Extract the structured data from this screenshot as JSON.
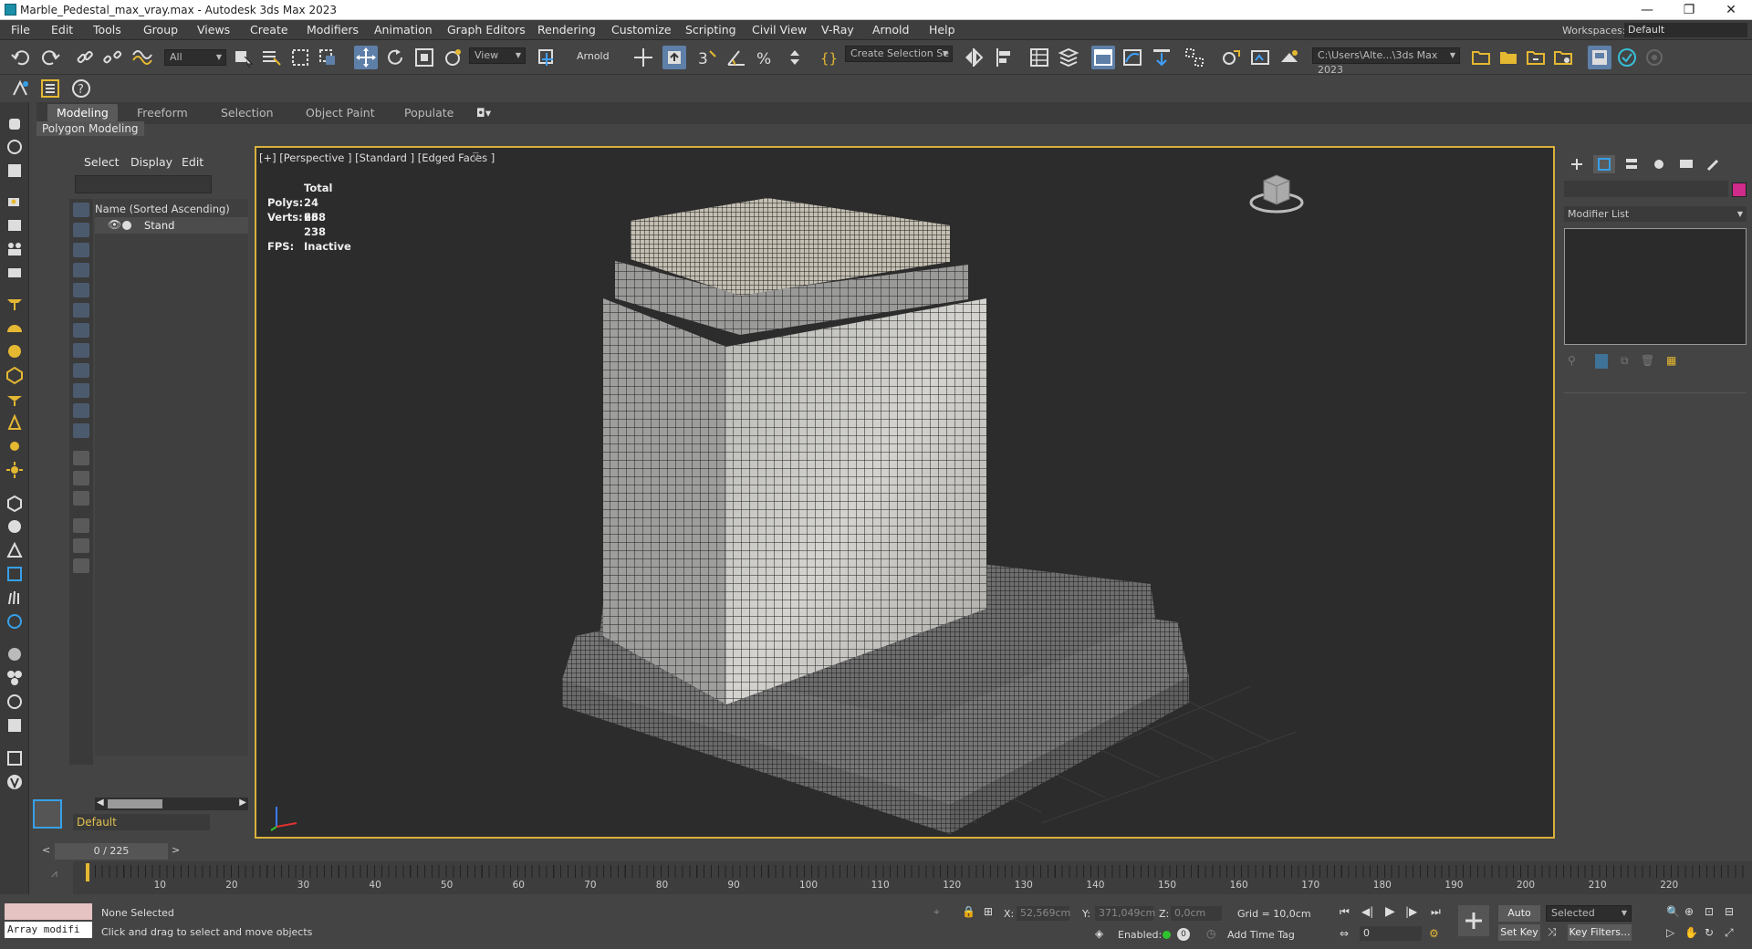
{
  "title_bar": {
    "title": "Marble_Pedestal_max_vray.max - Autodesk 3ds Max 2023",
    "minimize": "—",
    "restore": "❐",
    "close": "✕"
  },
  "menu": {
    "items": [
      "File",
      "Edit",
      "Tools",
      "Group",
      "Views",
      "Create",
      "Modifiers",
      "Animation",
      "Graph Editors",
      "Rendering",
      "Customize",
      "Scripting",
      "Civil View",
      "V-Ray",
      "Arnold",
      "Help"
    ],
    "workspaces_label": "Workspaces:",
    "workspaces_value": "Default"
  },
  "toolbar": {
    "selection_filter": "All",
    "ref_coord": "View",
    "arnold_label": "Arnold",
    "named_selection": "Create Selection Se",
    "project_path": "C:\\Users\\Alte...\\3ds Max 2023"
  },
  "ribbon": {
    "tabs": [
      "Modeling",
      "Freeform",
      "Selection",
      "Object Paint",
      "Populate"
    ],
    "active_tab": "Modeling",
    "panel_label": "Polygon Modeling"
  },
  "scene_explorer": {
    "tabs": [
      "Select",
      "Display",
      "Edit"
    ],
    "column_header": "Name (Sorted Ascending)",
    "objects": [
      {
        "name": "Stand"
      }
    ],
    "layer": "Default"
  },
  "viewport": {
    "label": "[+] [Perspective ] [Standard ] [Edged Faces ]",
    "stats": {
      "total_label": "Total",
      "polys_label": "Polys:",
      "polys_value": "24 668",
      "verts_label": "Verts:",
      "verts_value": "23 238",
      "fps_label": "FPS:",
      "fps_value": "Inactive"
    }
  },
  "command_panel": {
    "modifier_list": "Modifier List",
    "object_color": "#d02a8a"
  },
  "timeline": {
    "frame_display": "0 / 225",
    "ticks": [
      "10",
      "20",
      "30",
      "40",
      "50",
      "60",
      "70",
      "80",
      "90",
      "100",
      "110",
      "120",
      "130",
      "140",
      "150",
      "160",
      "170",
      "180",
      "190",
      "200",
      "210",
      "220"
    ]
  },
  "status": {
    "maxscript_text": "Array modifi",
    "selection_status": "None Selected",
    "prompt": "Click and drag to select and move objects",
    "x_label": "X:",
    "x_value": "52,569cm",
    "y_label": "Y:",
    "y_value": "371,049cm",
    "z_label": "Z:",
    "z_value": "0,0cm",
    "grid": "Grid = 10,0cm",
    "enabled_label": "Enabled:",
    "add_time_tag": "Add Time Tag",
    "auto_key": "Auto Key",
    "set_key": "Set Key",
    "key_mode": "Selected",
    "key_filters": "Key Filters...",
    "current_frame": "0"
  }
}
